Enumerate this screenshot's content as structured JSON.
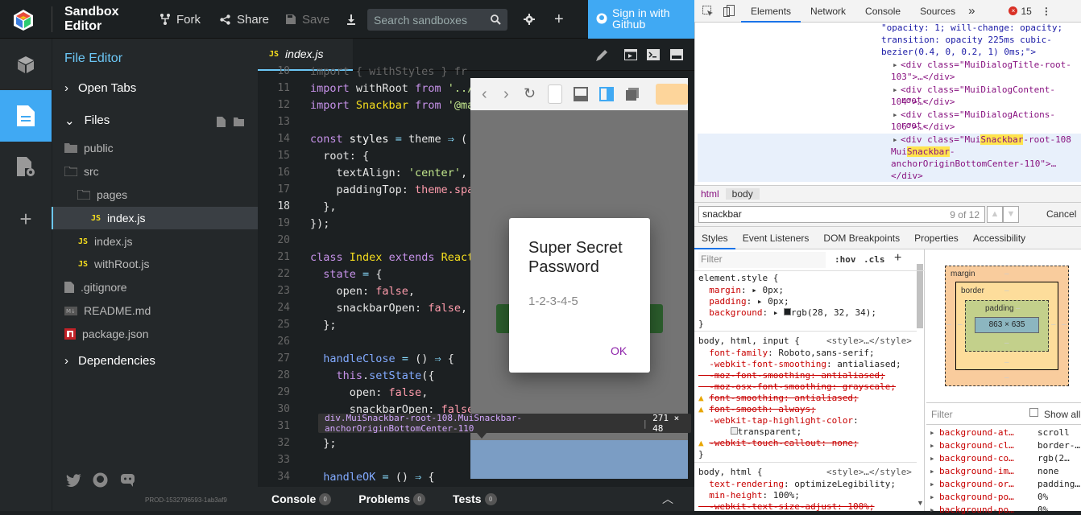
{
  "app": {
    "title_line1": "Sandbox",
    "title_line2": "Editor"
  },
  "toolbar": {
    "fork_label": "Fork",
    "share_label": "Share",
    "save_label": "Save",
    "search_placeholder": "Search sandboxes",
    "signin_line1": "Sign in with",
    "signin_line2": "Github"
  },
  "panel": {
    "title": "File Editor",
    "open_tabs": "Open Tabs",
    "files": "Files",
    "dependencies": "Dependencies",
    "version": "PROD-1532796593-1ab3af9",
    "tree": [
      {
        "name": "public",
        "type": "folder"
      },
      {
        "name": "src",
        "type": "folder"
      },
      {
        "name": "pages",
        "type": "folder"
      },
      {
        "name": "index.js",
        "type": "js"
      },
      {
        "name": "index.js",
        "type": "js"
      },
      {
        "name": "withRoot.js",
        "type": "js"
      },
      {
        "name": ".gitignore",
        "type": "file"
      },
      {
        "name": "README.md",
        "type": "md"
      },
      {
        "name": "package.json",
        "type": "json"
      }
    ]
  },
  "editor": {
    "tab": "index.js",
    "tab_icon": "JS",
    "line_numbers": [
      "10",
      "11",
      "12",
      "13",
      "14",
      "15",
      "16",
      "17",
      "18",
      "19",
      "20",
      "21",
      "22",
      "23",
      "24",
      "25",
      "26",
      "27",
      "28",
      "29",
      "30",
      "31",
      "32",
      "33",
      "34"
    ],
    "bottom_tabs": [
      {
        "label": "Console",
        "count": "0"
      },
      {
        "label": "Problems",
        "count": "0"
      },
      {
        "label": "Tests",
        "count": "0"
      }
    ]
  },
  "preview": {
    "dialog_title": "Super Secret Password",
    "dialog_body": "1-2-3-4-5",
    "dialog_ok": "OK",
    "tooltip_selector": "div.MuiSnackbar-root-108.MuiSnackbar-anchorOriginBottomCenter-110",
    "tooltip_size": "271 × 48"
  },
  "devtools": {
    "tabs": [
      "Elements",
      "Network",
      "Console",
      "Sources"
    ],
    "error_count": "15",
    "dom_line1": "\"opacity: 1; will-change: opacity;",
    "dom_line2": "transition: opacity 225ms cubic-",
    "dom_line3": "bezier(0.4, 0, 0.2, 1) 0ms;\">",
    "dom_line4": "<div class=\"MuiDialogTitle-root-",
    "dom_line5": "103\">…</div>",
    "dom_line6": "<div class=\"MuiDialogContent-root-",
    "dom_line7": "104\">…</div>",
    "dom_line8": "<div class=\"MuiDialogActions-root-",
    "dom_line9": "106\">…</div>",
    "dom_line12": "anchorOriginBottomCenter-110\">…",
    "dom_line13": "</div>",
    "breadcrumbs": [
      "html",
      "body"
    ],
    "find_value": "snackbar",
    "find_count": "9 of 12",
    "find_cancel": "Cancel",
    "style_tabs": [
      "Styles",
      "Event Listeners",
      "DOM Breakpoints",
      "Properties",
      "Accessibility"
    ],
    "filter_placeholder": "Filter",
    "hov": ":hov",
    "cls": ".cls",
    "box": {
      "margin": "margin",
      "border": "border",
      "padding": "padding",
      "content": "863 × 635",
      "dash": "–"
    },
    "computed_filter": "Filter",
    "show_all": "Show all",
    "computed": [
      {
        "prop": "background-at…",
        "value": "scroll"
      },
      {
        "prop": "background-cl…",
        "value": "border-…"
      },
      {
        "prop": "background-co…",
        "value": "rgb(2…"
      },
      {
        "prop": "background-im…",
        "value": "none"
      },
      {
        "prop": "background-or…",
        "value": "padding…"
      },
      {
        "prop": "background-po…",
        "value": "0%"
      },
      {
        "prop": "background-po…",
        "value": "0%"
      }
    ]
  }
}
